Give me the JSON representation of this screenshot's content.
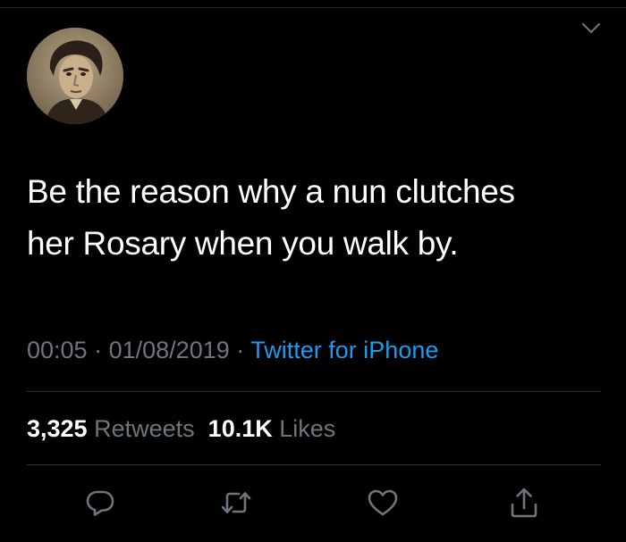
{
  "tweet": {
    "text_line1": "Be the reason why a nun clutches",
    "text_line2": "her Rosary when you walk by.",
    "time": "00:05",
    "date": "01/08/2019",
    "separator": "·",
    "source": "Twitter for iPhone"
  },
  "stats": {
    "retweets_count": "3,325",
    "retweets_label": "Retweets",
    "likes_count": "10.1K",
    "likes_label": "Likes"
  },
  "actions": {
    "icons": [
      "reply-icon",
      "retweet-icon",
      "like-icon",
      "share-icon"
    ]
  },
  "colors": {
    "background": "#000000",
    "text": "#ffffff",
    "secondary": "#6e767d",
    "accent": "#1d9bf0",
    "divider": "#2f3336"
  }
}
